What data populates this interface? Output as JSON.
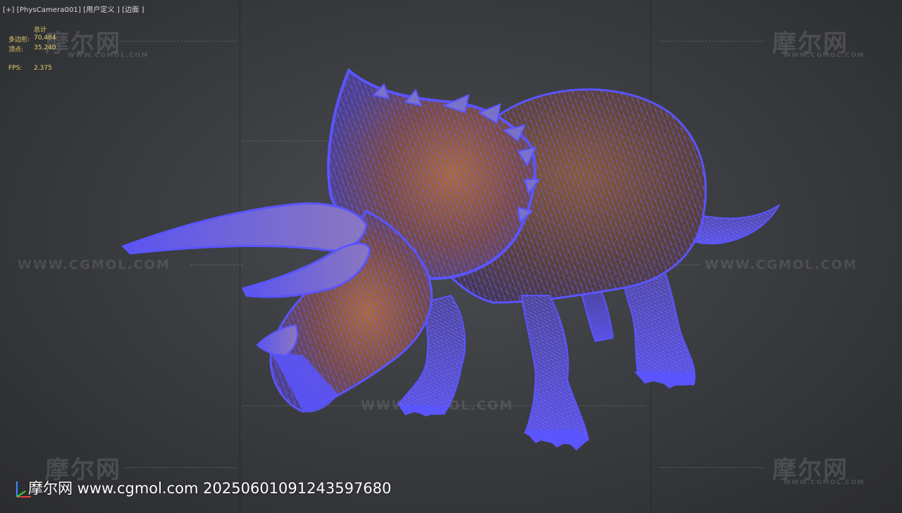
{
  "viewport": {
    "label": "[+] [PhysCamera001] [用户定义 ] [边面 ]"
  },
  "stats": {
    "header": "总计",
    "polygons_label": "多边形:",
    "polygons_value": "70,484",
    "vertices_label": "顶点:",
    "vertices_value": "35,240",
    "fps_label": "FPS:",
    "fps_value": "2.375"
  },
  "watermark": {
    "logo": "摩尔网",
    "logo_sub": "WWW.CGMOL.COM",
    "url": "WWW.CGMOL.COM"
  },
  "footer": {
    "caption": "摩尔网 www.cgmol.com 20250601091243597680"
  },
  "colors": {
    "wireframe": "#5a55ff",
    "stats_text": "#e8d36a",
    "background": "#3b3d41"
  },
  "icons": {
    "axis": "axis-gizmo-icon"
  }
}
